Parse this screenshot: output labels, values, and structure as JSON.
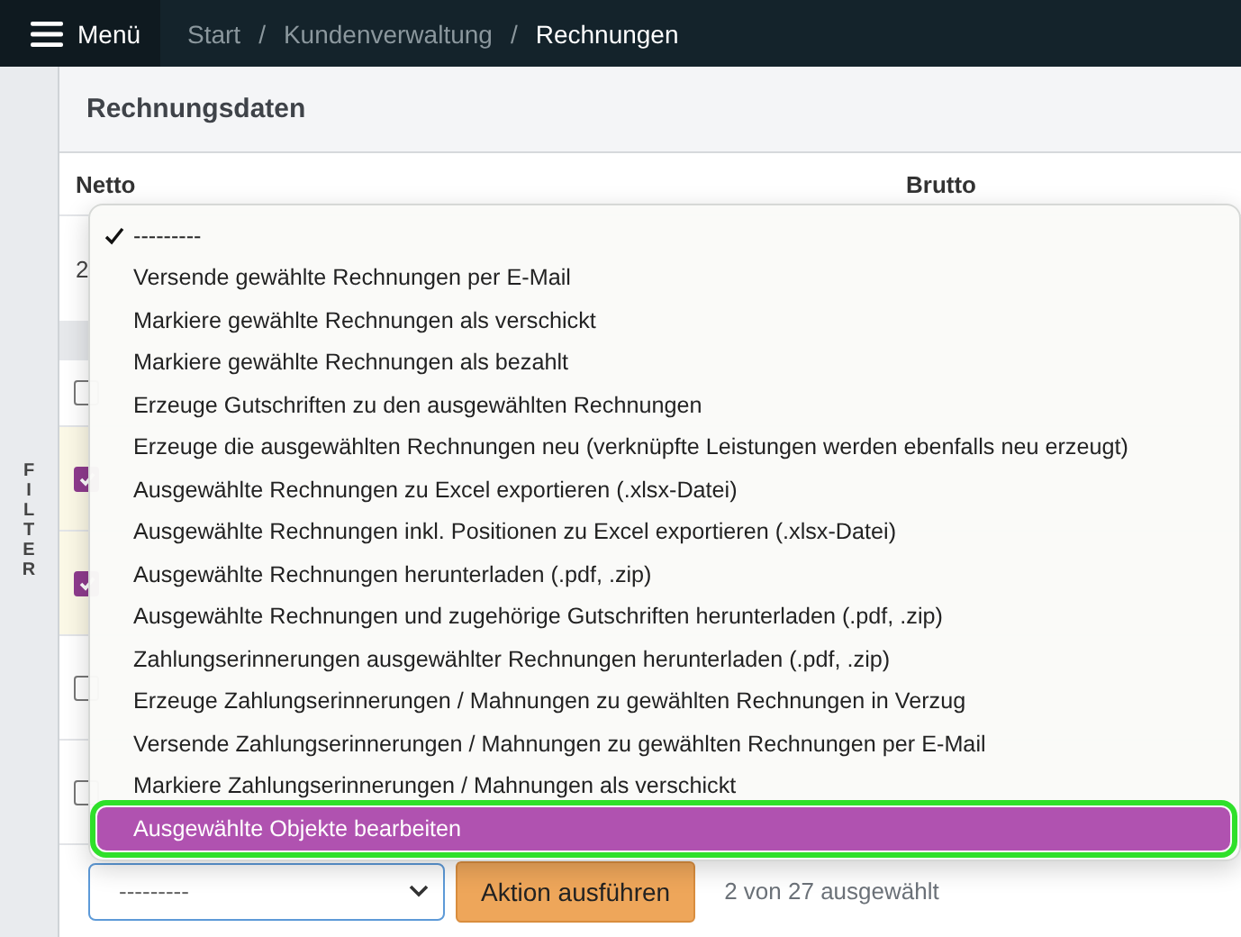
{
  "top_bar": {
    "menu_label": "Menü",
    "separator": "/",
    "breadcrumbs": [
      {
        "label": "Start",
        "current": false
      },
      {
        "label": "Kundenverwaltung",
        "current": false
      },
      {
        "label": "Rechnungen",
        "current": true
      }
    ]
  },
  "filter_tab": {
    "label": "FILTER"
  },
  "card": {
    "title": "Rechnungsdaten",
    "columns": [
      "Netto",
      "Brutto"
    ],
    "row_value": "2"
  },
  "table": {
    "rows": [
      {
        "checked": false
      },
      {
        "checked": true
      },
      {
        "checked": true
      },
      {
        "checked": false
      },
      {
        "checked": false
      }
    ]
  },
  "dropdown": {
    "options": [
      {
        "label": "---------",
        "checked": true,
        "highlighted": false
      },
      {
        "label": "Versende gewählte Rechnungen per E-Mail",
        "checked": false,
        "highlighted": false
      },
      {
        "label": "Markiere gewählte Rechnungen als verschickt",
        "checked": false,
        "highlighted": false
      },
      {
        "label": "Markiere gewählte Rechnungen als bezahlt",
        "checked": false,
        "highlighted": false
      },
      {
        "label": "Erzeuge Gutschriften zu den ausgewählten Rechnungen",
        "checked": false,
        "highlighted": false
      },
      {
        "label": "Erzeuge die ausgewählten Rechnungen neu (verknüpfte Leistungen werden ebenfalls neu erzeugt)",
        "checked": false,
        "highlighted": false
      },
      {
        "label": "Ausgewählte Rechnungen zu Excel exportieren (.xlsx-Datei)",
        "checked": false,
        "highlighted": false
      },
      {
        "label": "Ausgewählte Rechnungen inkl. Positionen zu Excel exportieren (.xlsx-Datei)",
        "checked": false,
        "highlighted": false
      },
      {
        "label": "Ausgewählte Rechnungen herunterladen (.pdf, .zip)",
        "checked": false,
        "highlighted": false
      },
      {
        "label": "Ausgewählte Rechnungen und zugehörige Gutschriften herunterladen (.pdf, .zip)",
        "checked": false,
        "highlighted": false
      },
      {
        "label": "Zahlungserinnerungen ausgewählter Rechnungen herunterladen (.pdf, .zip)",
        "checked": false,
        "highlighted": false
      },
      {
        "label": "Erzeuge Zahlungserinnerungen / Mahnungen zu gewählten Rechnungen in Verzug",
        "checked": false,
        "highlighted": false
      },
      {
        "label": "Versende Zahlungserinnerungen / Mahnungen zu gewählten Rechnungen per E-Mail",
        "checked": false,
        "highlighted": false
      },
      {
        "label": "Markiere Zahlungserinnerungen / Mahnungen als verschickt",
        "checked": false,
        "highlighted": false
      },
      {
        "label": "Ausgewählte Objekte bearbeiten",
        "checked": false,
        "highlighted": true
      }
    ]
  },
  "action_bar": {
    "select_value": "---------",
    "button": "Aktion ausführen",
    "selection_count": "2 von 27 ausgewählt"
  }
}
